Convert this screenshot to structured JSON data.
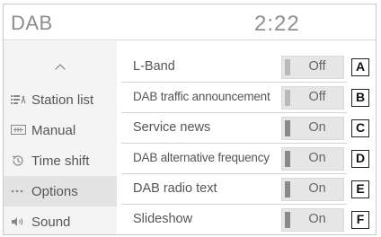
{
  "header": {
    "title": "DAB",
    "clock": "2:22"
  },
  "sidebar": {
    "items": [
      {
        "icon": "station-list-icon",
        "label": "Station list"
      },
      {
        "icon": "manual-icon",
        "label": "Manual"
      },
      {
        "icon": "time-shift-icon",
        "label": "Time shift"
      },
      {
        "icon": "options-icon",
        "label": "Options",
        "selected": true
      },
      {
        "icon": "sound-icon",
        "label": "Sound"
      }
    ]
  },
  "settings": [
    {
      "label": "L-Band",
      "state": "Off",
      "callout": "A"
    },
    {
      "label": "DAB traffic announcement",
      "state": "Off",
      "callout": "B"
    },
    {
      "label": "Service news",
      "state": "On",
      "callout": "C"
    },
    {
      "label": "DAB alternative frequency",
      "state": "On",
      "callout": "D"
    },
    {
      "label": "DAB radio text",
      "state": "On",
      "callout": "E"
    },
    {
      "label": "Slideshow",
      "state": "On",
      "callout": "F"
    }
  ],
  "colors": {
    "selected_bg": "#e3e3e3",
    "toggle_on_bar": "#8a8a8a",
    "toggle_off_bar": "#b9b9b9"
  }
}
